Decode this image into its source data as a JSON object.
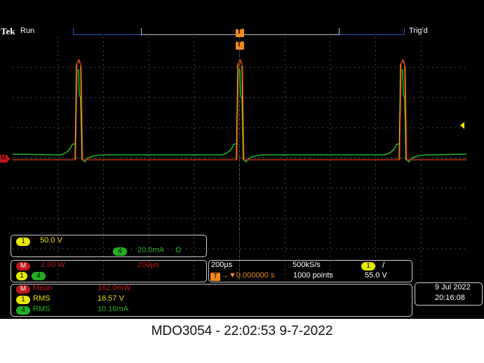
{
  "header": {
    "brand": "Tek",
    "run_state": "Run",
    "trigger_status": "Trig'd",
    "trigger_marker": "T"
  },
  "markers": {
    "math_ref": "M"
  },
  "channel_box": {
    "ch1_badge": "1",
    "ch1_scale": "50.0 V",
    "ch4_badge": "4",
    "ch4_scale": "20.0mA",
    "ch4_coupling_symbol": "Ω"
  },
  "math_box": {
    "math_badge": "M",
    "math_scale": "2.00 W",
    "math_timebase": "200µs",
    "src1_badge": "1",
    "src2_badge": "4"
  },
  "timebase_box": {
    "horizontal_scale": "200µs",
    "sample_rate": "500kS/s",
    "trigger_source_badge": "1",
    "trigger_slope": "/",
    "trigger_delay_icon": "T",
    "trigger_delay": "→▼0.000000 s",
    "record_length": "1000 points",
    "trigger_level": "55.0 V"
  },
  "measurements": [
    {
      "badge": "M",
      "name": "Mean",
      "value": "162.0mW",
      "color": "#c01818"
    },
    {
      "badge": "1",
      "name": "RMS",
      "value": "16.57 V",
      "color": "#e8e800"
    },
    {
      "badge": "4",
      "name": "RMS",
      "value": "10.16mA",
      "color": "#22b022"
    }
  ],
  "datetime": {
    "date": "9 Jul  2022",
    "time": "20:16:08"
  },
  "caption": "MDO3054 - 22:02:53   9-7-2022",
  "colors": {
    "ch1": "#e8e800",
    "ch4": "#22b022",
    "math": "#c01818",
    "graticule": "#8a8a8a",
    "accent_orange": "#f08a1a",
    "frame_blue": "#2a50c8"
  }
}
